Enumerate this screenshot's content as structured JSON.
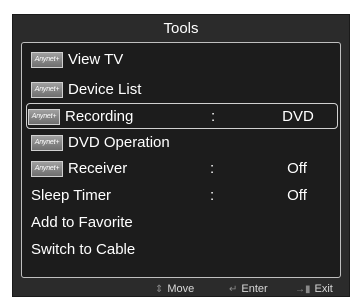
{
  "menu": {
    "title": "Tools",
    "items": [
      {
        "label": "View TV",
        "icon": "Anynet+",
        "value": ""
      },
      {
        "label": "Device List",
        "icon": "Anynet+",
        "value": ""
      },
      {
        "label": "Recording",
        "icon": "Anynet+",
        "colon": ":",
        "value": "DVD"
      },
      {
        "label": "DVD Operation",
        "icon": "Anynet+",
        "value": ""
      },
      {
        "label": "Receiver",
        "icon": "Anynet+",
        "colon": ":",
        "value": "Off"
      },
      {
        "label": "Sleep Timer",
        "colon": ":",
        "value": "Off"
      },
      {
        "label": "Add to Favorite",
        "value": ""
      },
      {
        "label": "Switch to Cable",
        "value": ""
      }
    ]
  },
  "footer": {
    "move_label": "Move",
    "move_icon": "updown-arrow-icon",
    "enter_label": "Enter",
    "enter_icon": "enter-icon",
    "exit_label": "Exit",
    "exit_icon": "exit-icon"
  }
}
